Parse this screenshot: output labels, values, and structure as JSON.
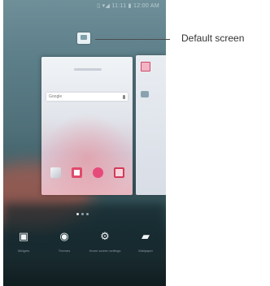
{
  "callout": {
    "label": "Default screen"
  },
  "status_bar": {
    "text": "▯ ▾◢ 11:11 ▮ 12:00 AM"
  },
  "home_editor": {
    "search_hint": "Google",
    "page_count": 3,
    "current_page": 1
  },
  "bottom_menu": {
    "items": [
      {
        "label": "Widgets",
        "icon": "widgets-icon"
      },
      {
        "label": "Themes",
        "icon": "palette-icon"
      },
      {
        "label": "Home screen settings",
        "icon": "gear-icon"
      },
      {
        "label": "Wallpaper",
        "icon": "wallpaper-icon"
      }
    ]
  }
}
